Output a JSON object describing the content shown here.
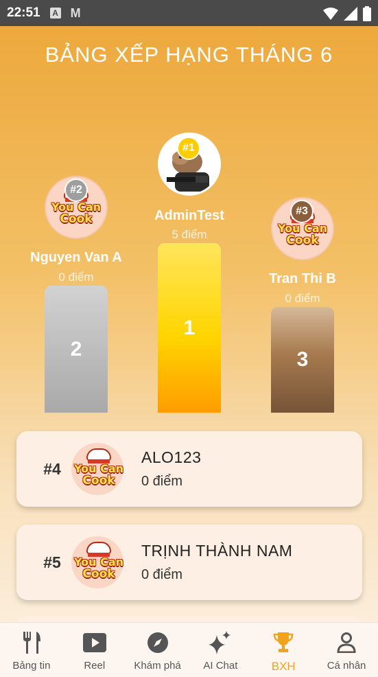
{
  "status_bar": {
    "time": "22:51",
    "a_icon_label": "A",
    "mail_icon_label": "M"
  },
  "title": "BẢNG XẾP HẠNG THÁNG 6",
  "podium": [
    {
      "rank": "#2",
      "name": "Nguyen Van A",
      "points": "0 điểm",
      "bar_label": "2",
      "logo_line1": "You Can",
      "logo_line2": "Cook"
    },
    {
      "rank": "#1",
      "name": "AdminTest",
      "points": "5 điểm",
      "bar_label": "1"
    },
    {
      "rank": "#3",
      "name": "Tran Thi B",
      "points": "0 điểm",
      "bar_label": "3",
      "logo_line1": "You Can",
      "logo_line2": "Cook"
    }
  ],
  "list": [
    {
      "rank": "#4",
      "name": "ALO123",
      "points": "0 điểm",
      "logo_line1": "You Can",
      "logo_line2": "Cook"
    },
    {
      "rank": "#5",
      "name": "TRỊNH THÀNH NAM",
      "points": "0 điểm",
      "logo_line1": "You Can",
      "logo_line2": "Cook"
    }
  ],
  "nav": [
    {
      "label": "Bảng tin",
      "icon": "fork-knife-icon"
    },
    {
      "label": "Reel",
      "icon": "play-icon"
    },
    {
      "label": "Khám phá",
      "icon": "compass-icon"
    },
    {
      "label": "AI Chat",
      "icon": "sparkle-icon"
    },
    {
      "label": "BXH",
      "icon": "trophy-icon",
      "active": true
    },
    {
      "label": "Cá nhân",
      "icon": "person-icon"
    }
  ],
  "colors": {
    "accent": "#f0a31c",
    "gold": "#ffd500",
    "silver": "#b0b0b0",
    "bronze": "#8b5e3c"
  }
}
